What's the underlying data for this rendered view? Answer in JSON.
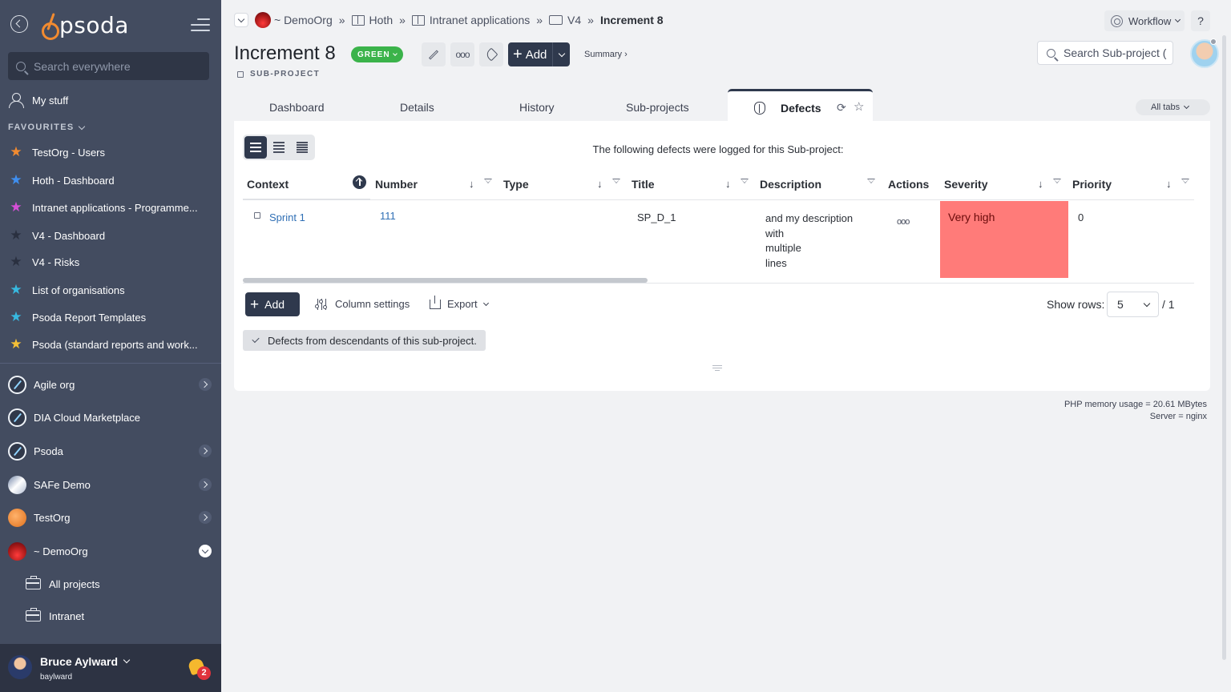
{
  "sidebar": {
    "brand": "psoda",
    "search_placeholder": "Search everywhere",
    "my_stuff": "My stuff",
    "favourites_heading": "FAVOURITES",
    "favourites": [
      {
        "label": "TestOrg - Users",
        "color": "#f28b30"
      },
      {
        "label": "Hoth - Dashboard",
        "color": "#3f8ff0"
      },
      {
        "label": "Intranet applications - Programme...",
        "color": "#d64fd8"
      },
      {
        "label": "V4 - Dashboard",
        "color": "#30384a"
      },
      {
        "label": "V4 - Risks",
        "color": "#30384a"
      },
      {
        "label": "List of organisations",
        "color": "#37b9e0"
      },
      {
        "label": "Psoda Report Templates",
        "color": "#37b9e0"
      },
      {
        "label": "Psoda (standard reports and work...",
        "color": "#f5c036"
      }
    ],
    "organisations": [
      {
        "label": "Agile org",
        "logo": "blue",
        "arrow": "right"
      },
      {
        "label": "DIA Cloud Marketplace",
        "logo": "blue",
        "arrow": "none"
      },
      {
        "label": "Psoda",
        "logo": "blue",
        "arrow": "right"
      },
      {
        "label": "SAFe Demo",
        "logo": "safe",
        "arrow": "right"
      },
      {
        "label": "TestOrg",
        "logo": "test",
        "arrow": "right"
      },
      {
        "label": "~ DemoOrg",
        "logo": "demo",
        "arrow": "down"
      }
    ],
    "sub_items": [
      {
        "label": "All projects"
      },
      {
        "label": "Intranet"
      }
    ],
    "user": {
      "name": "Bruce Aylward",
      "username": "baylward",
      "notifications": "2"
    }
  },
  "breadcrumb": {
    "items": [
      "~ DemoOrg",
      "Hoth",
      "Intranet applications",
      "V4",
      "Increment 8"
    ],
    "separator": "»"
  },
  "header": {
    "workflow_label": "Workflow",
    "help_label": "?",
    "title": "Increment 8",
    "status": "GREEN",
    "type": "SUB-PROJECT",
    "add_label": "Add",
    "summary_label": "Summary ›",
    "search_placeholder": "Search Sub-project (",
    "more_dots": "ooo"
  },
  "tabs": {
    "items": [
      "Dashboard",
      "Details",
      "History",
      "Sub-projects"
    ],
    "active": "Defects",
    "all_tabs": "All tabs"
  },
  "defects": {
    "intro": "The following defects were logged for this Sub-project:",
    "columns": [
      "Context",
      "Number",
      "Type",
      "Title",
      "Description",
      "Actions",
      "Severity",
      "Priority"
    ],
    "rows": [
      {
        "context": "Sprint 1",
        "number": "111",
        "type": "",
        "title": "SP_D_1",
        "description": [
          "and my description",
          "with",
          "multiple",
          "lines"
        ],
        "actions": "ooo",
        "severity": "Very high",
        "severity_color": "#ff7b79",
        "priority": "0"
      }
    ],
    "add_label": "Add",
    "column_settings_label": "Column settings",
    "export_label": "Export",
    "show_rows_label": "Show rows:",
    "show_rows_value": "5",
    "pages": "/ 1",
    "descendants_chip": "Defects from descendants of this sub-project."
  },
  "footer": {
    "memory": "PHP memory usage = 20.61 MBytes",
    "server": "Server = nginx"
  }
}
